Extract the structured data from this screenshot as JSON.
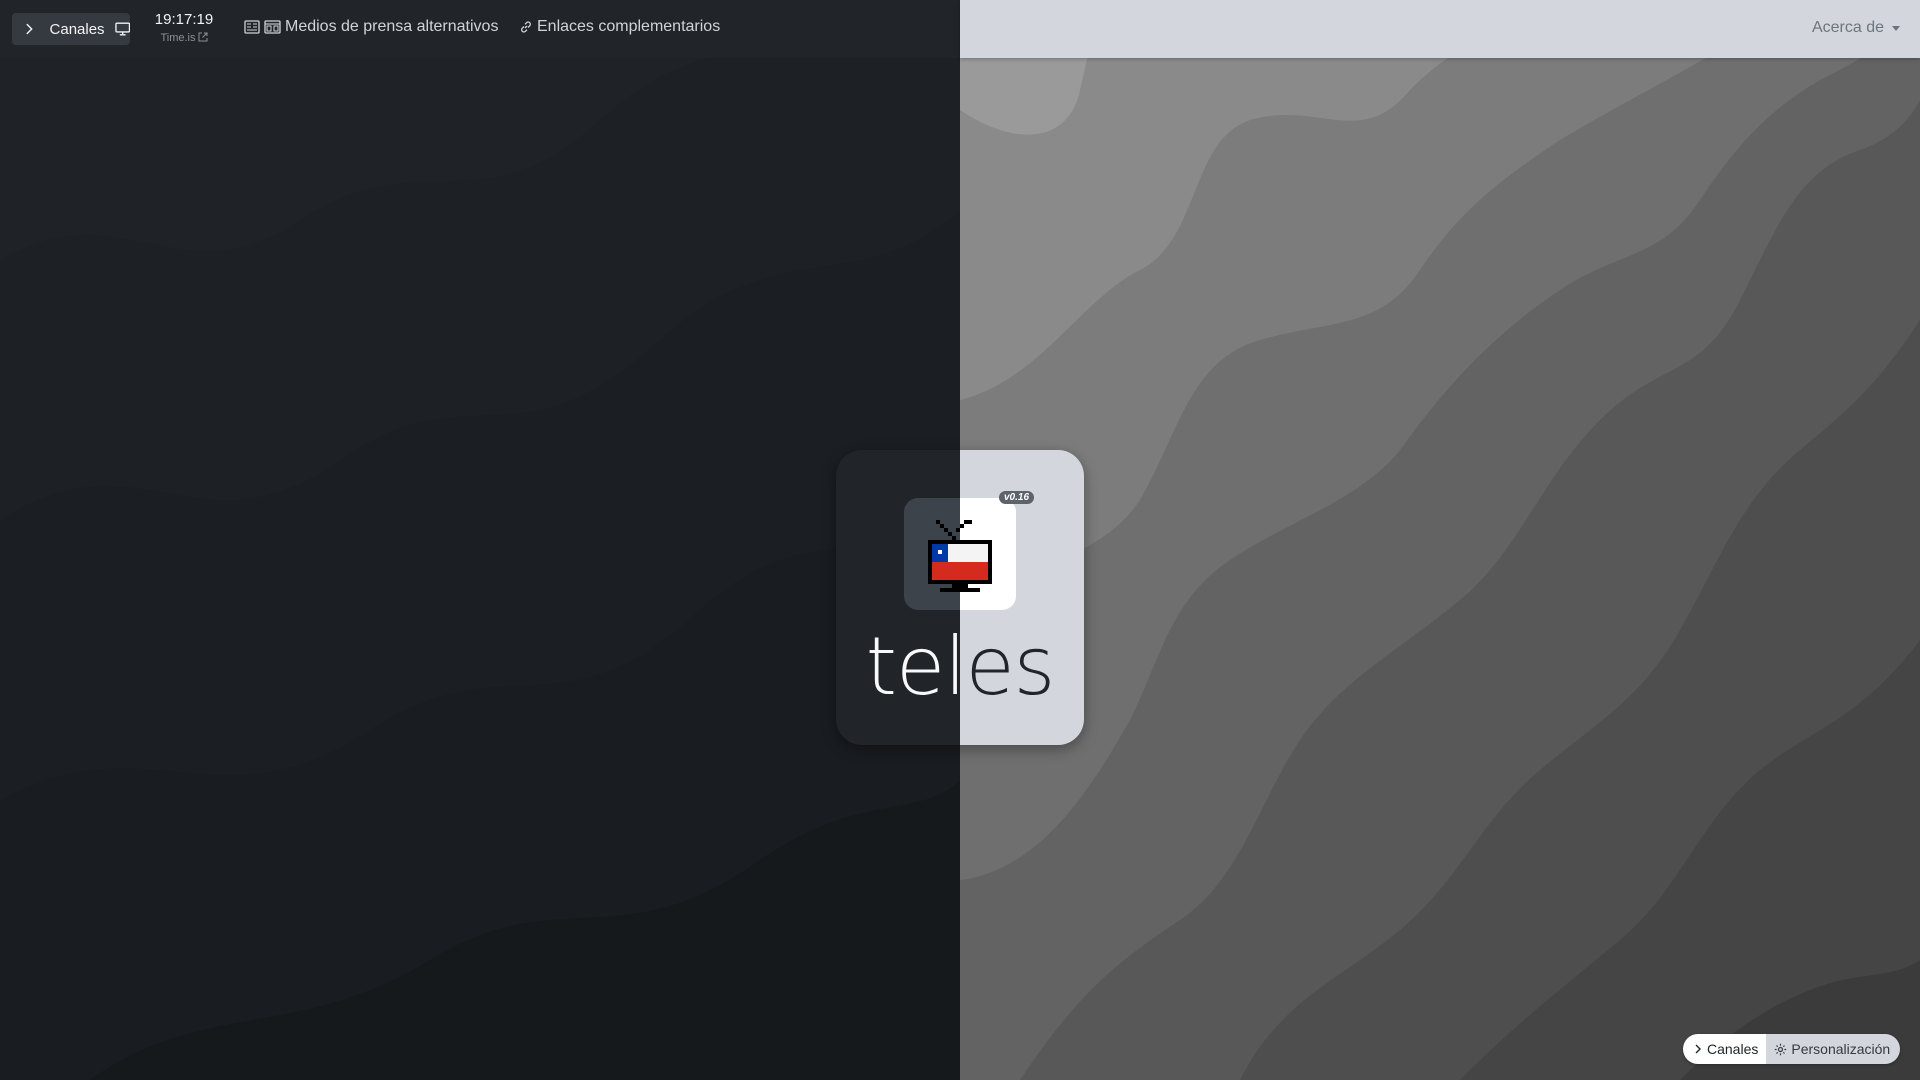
{
  "header": {
    "channels_button_label": "Canales",
    "clock": {
      "time": "19:17:19",
      "source": "Time.is"
    },
    "nav": [
      {
        "label": "Medios de prensa alternativos"
      },
      {
        "label": "Enlaces complementarios"
      }
    ],
    "about_label": "Acerca de"
  },
  "hero": {
    "version": "v0.16",
    "brand": "teles"
  },
  "bottom_pill": {
    "channels_label": "Canales",
    "customize_label": "Personalización"
  },
  "colors": {
    "dark_bg": "#1e2125",
    "light_navbar": "#d3d7dd",
    "flag_red": "#d52b1e",
    "flag_blue": "#0039a6"
  }
}
